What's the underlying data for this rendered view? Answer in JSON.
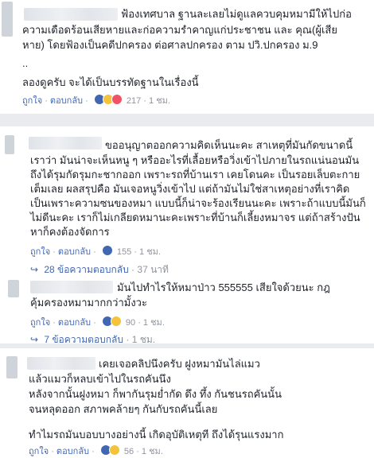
{
  "comments": [
    {
      "name": "",
      "lines": [
        "ฟ้องเทศบาล ฐานละเลยไม่ดูแลควบคุมหมามีให้ไปก่อ",
        "ความเดือดร้อนเสียหายและก่อความรำคาญแก่ประชาชน และ คุณ(ผู้เสีย",
        "หาย) โดยฟ้องเป็นคดีปกครอง ต่อศาลปกครอง ตาม ปวิ.ปกครอง ม.9",
        "..",
        "ลองดูครับ จะได้เป็นบรรทัดฐานในเรื่องนี้"
      ],
      "like": "ถูกใจ",
      "reply": "ตอบกลับ",
      "count": "217",
      "time": "1 ชม."
    },
    {
      "name": "",
      "lines": [
        "ขออนุญาตออกความคิดเห็นนะคะ สาเหตุที่มันกัดขนาดนี้",
        "เราว่า มันน่าจะเห็นหนู ๆ หรืออะไรที่เลื้อยหรือวิ่งเข้าไปภายในรถแน่นอนมัน",
        "ถึงได้รุมกัดรุมกะชากออก เพราะรถที่บ้านเรา เคยโดนคะ เป็นรอยเล็บตะกาย",
        "เต็มเลย ผลสรุปคือ มันเจอหนูวิ่งเข้าไป แต่ถ้ามันไม่ใช่สาเหตุอย่างที่เราคิด",
        "เป็นเพราะความซนของหมา แบบนี้ก็น่าจะร้องเรียนนะคะ เพราะถ้าแบบนี้มันก็",
        "ไม่ดีนะคะ เราก็ไม่เกลียดหมานะคะเพราะที่บ้านก็เลี้ยงหมาจร แต่ถ้าสร้างปัน",
        "หาก็คงต้องจัดการ"
      ],
      "like": "ถูกใจ",
      "reply": "ตอบกลับ",
      "count": "155",
      "time": "1 ชม.",
      "replies_label": "28 ข้อความตอบกลับ",
      "replies_time": "37 นาที"
    },
    {
      "name": "",
      "lines": [
        "มันไปทำไรให้หมาป่าว 555555 เสียใจด้วยนะ กฎ",
        "คุ้มครองหมามากกว่ามั้งวะ"
      ],
      "like": "ถูกใจ",
      "reply": "ตอบกลับ",
      "count": "90",
      "time": "1 ชม.",
      "replies_label": "7 ข้อความตอบกลับ",
      "replies_time": "1 ชม."
    },
    {
      "name": "",
      "lines": [
        "เคยเจอคลิปนึงครับ ฝูงหมามันไล่แมว",
        "แล้วแมวก็หลบเข้าไปในรถคันนึง",
        "หลังจากนั้นฝูงหมา ก็พากันรุมย่ำกัด ดึง ทึ้ง กันชนรถคันนั้น",
        "จนหลุดออก สภาพคล้ายๆ กันกับรถคันนี้เลย",
        "",
        "ทำไมรถมันบอบบางอย่างนี้ เกิดอุบัติเหตุที ถึงได้รุนแรงมาก"
      ],
      "like": "ถูกใจ",
      "reply": "ตอบกลับ",
      "count": "56",
      "time": "1 ชม."
    }
  ],
  "colors": {
    "link": "#4267b2",
    "muted": "#90949c",
    "band": "#e9ebee"
  }
}
